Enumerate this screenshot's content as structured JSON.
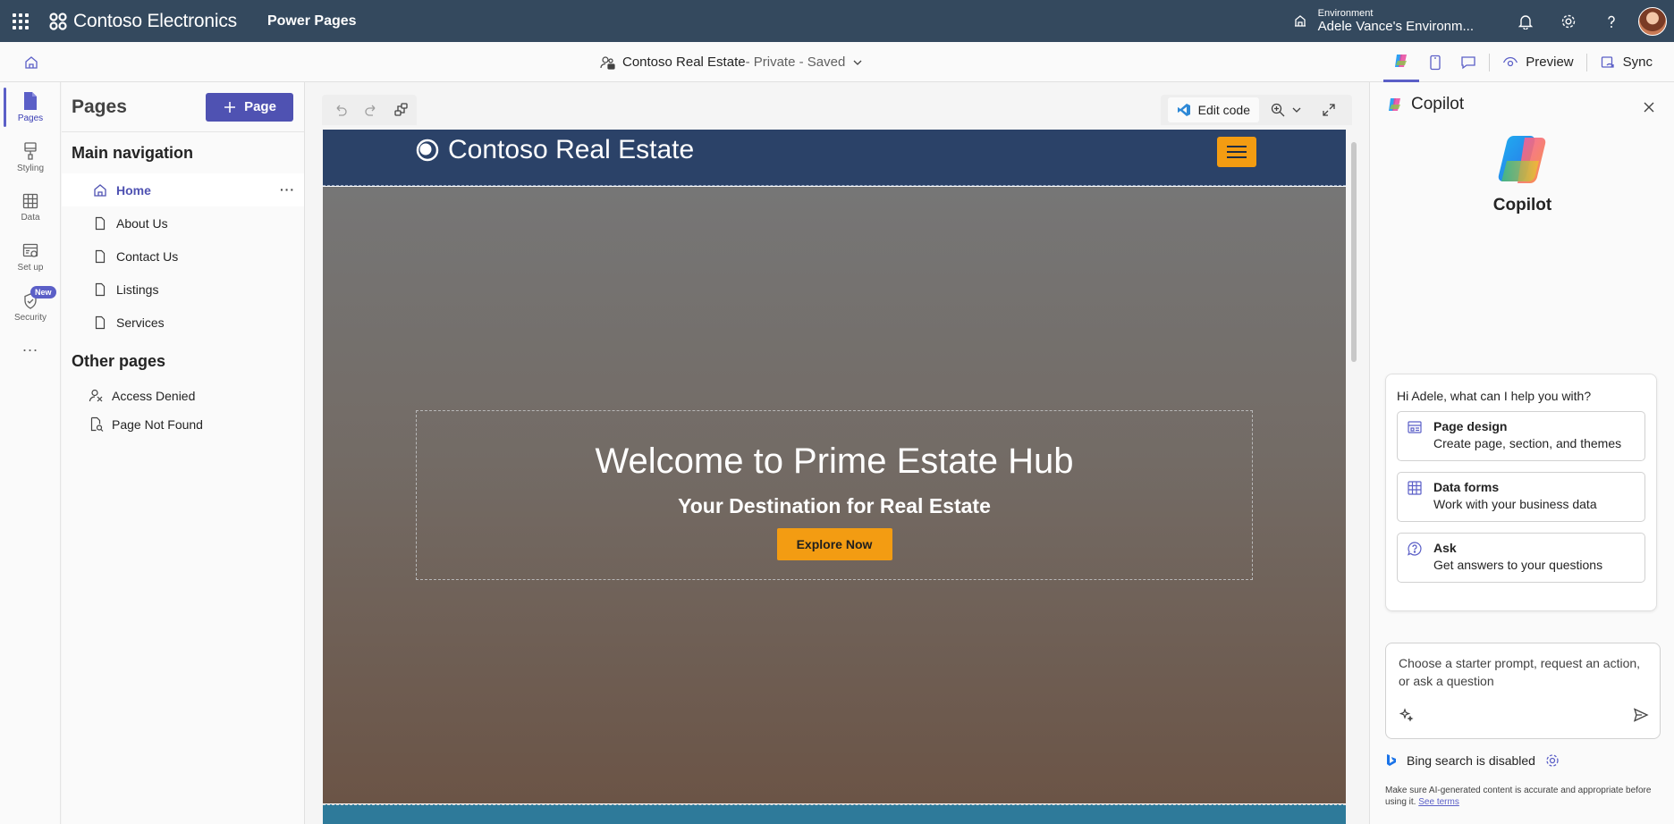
{
  "topbar": {
    "brand": "Contoso Electronics",
    "app_name": "Power Pages",
    "environment_label": "Environment",
    "environment_value": "Adele Vance's Environm...",
    "icons": [
      "waffle-icon",
      "environment-icon",
      "bell-icon",
      "gear-icon",
      "help-icon"
    ]
  },
  "cmdbar": {
    "site_name": "Contoso Real Estate",
    "site_status": " - Private - Saved",
    "preview_label": "Preview",
    "sync_label": "Sync"
  },
  "rail": {
    "items": [
      {
        "label": "Pages",
        "icon": "page-icon"
      },
      {
        "label": "Styling",
        "icon": "brush-icon"
      },
      {
        "label": "Data",
        "icon": "table-icon"
      },
      {
        "label": "Set up",
        "icon": "setup-icon"
      },
      {
        "label": "Security",
        "icon": "shield-icon"
      }
    ],
    "new_badge": "New",
    "more": "..."
  },
  "pages_panel": {
    "title": "Pages",
    "add_button": "Page",
    "main_nav_heading": "Main navigation",
    "main_nav": [
      "Home",
      "About Us",
      "Contact Us",
      "Listings",
      "Services"
    ],
    "other_heading": "Other pages",
    "other_pages": [
      "Access Denied",
      "Page Not Found"
    ],
    "more_icon": "···"
  },
  "canvas": {
    "edit_code_label": "Edit code",
    "site_logo_text": "Contoso Real Estate",
    "hero_title": "Welcome to Prime Estate Hub",
    "hero_subtitle": "Your Destination for Real Estate",
    "hero_cta": "Explore Now",
    "colors": {
      "header": "#2b4268",
      "accent": "#f39c12",
      "footer": "#2e7a9a"
    }
  },
  "copilot": {
    "title": "Copilot",
    "hero_name": "Copilot",
    "greeting": "Hi Adele, what can I help you with?",
    "options": [
      {
        "title": "Page design",
        "desc": "Create page, section, and themes",
        "icon": "layout-icon"
      },
      {
        "title": "Data forms",
        "desc": "Work with your business data",
        "icon": "table-icon"
      },
      {
        "title": "Ask",
        "desc": "Get answers to your questions",
        "icon": "chat-question-icon"
      }
    ],
    "input_placeholder": "Choose a starter prompt, request an action, or ask a question",
    "bing_status": "Bing search is disabled",
    "disclaimer": "Make sure AI-generated content is accurate and appropriate before using it.",
    "see_terms": "See terms"
  }
}
